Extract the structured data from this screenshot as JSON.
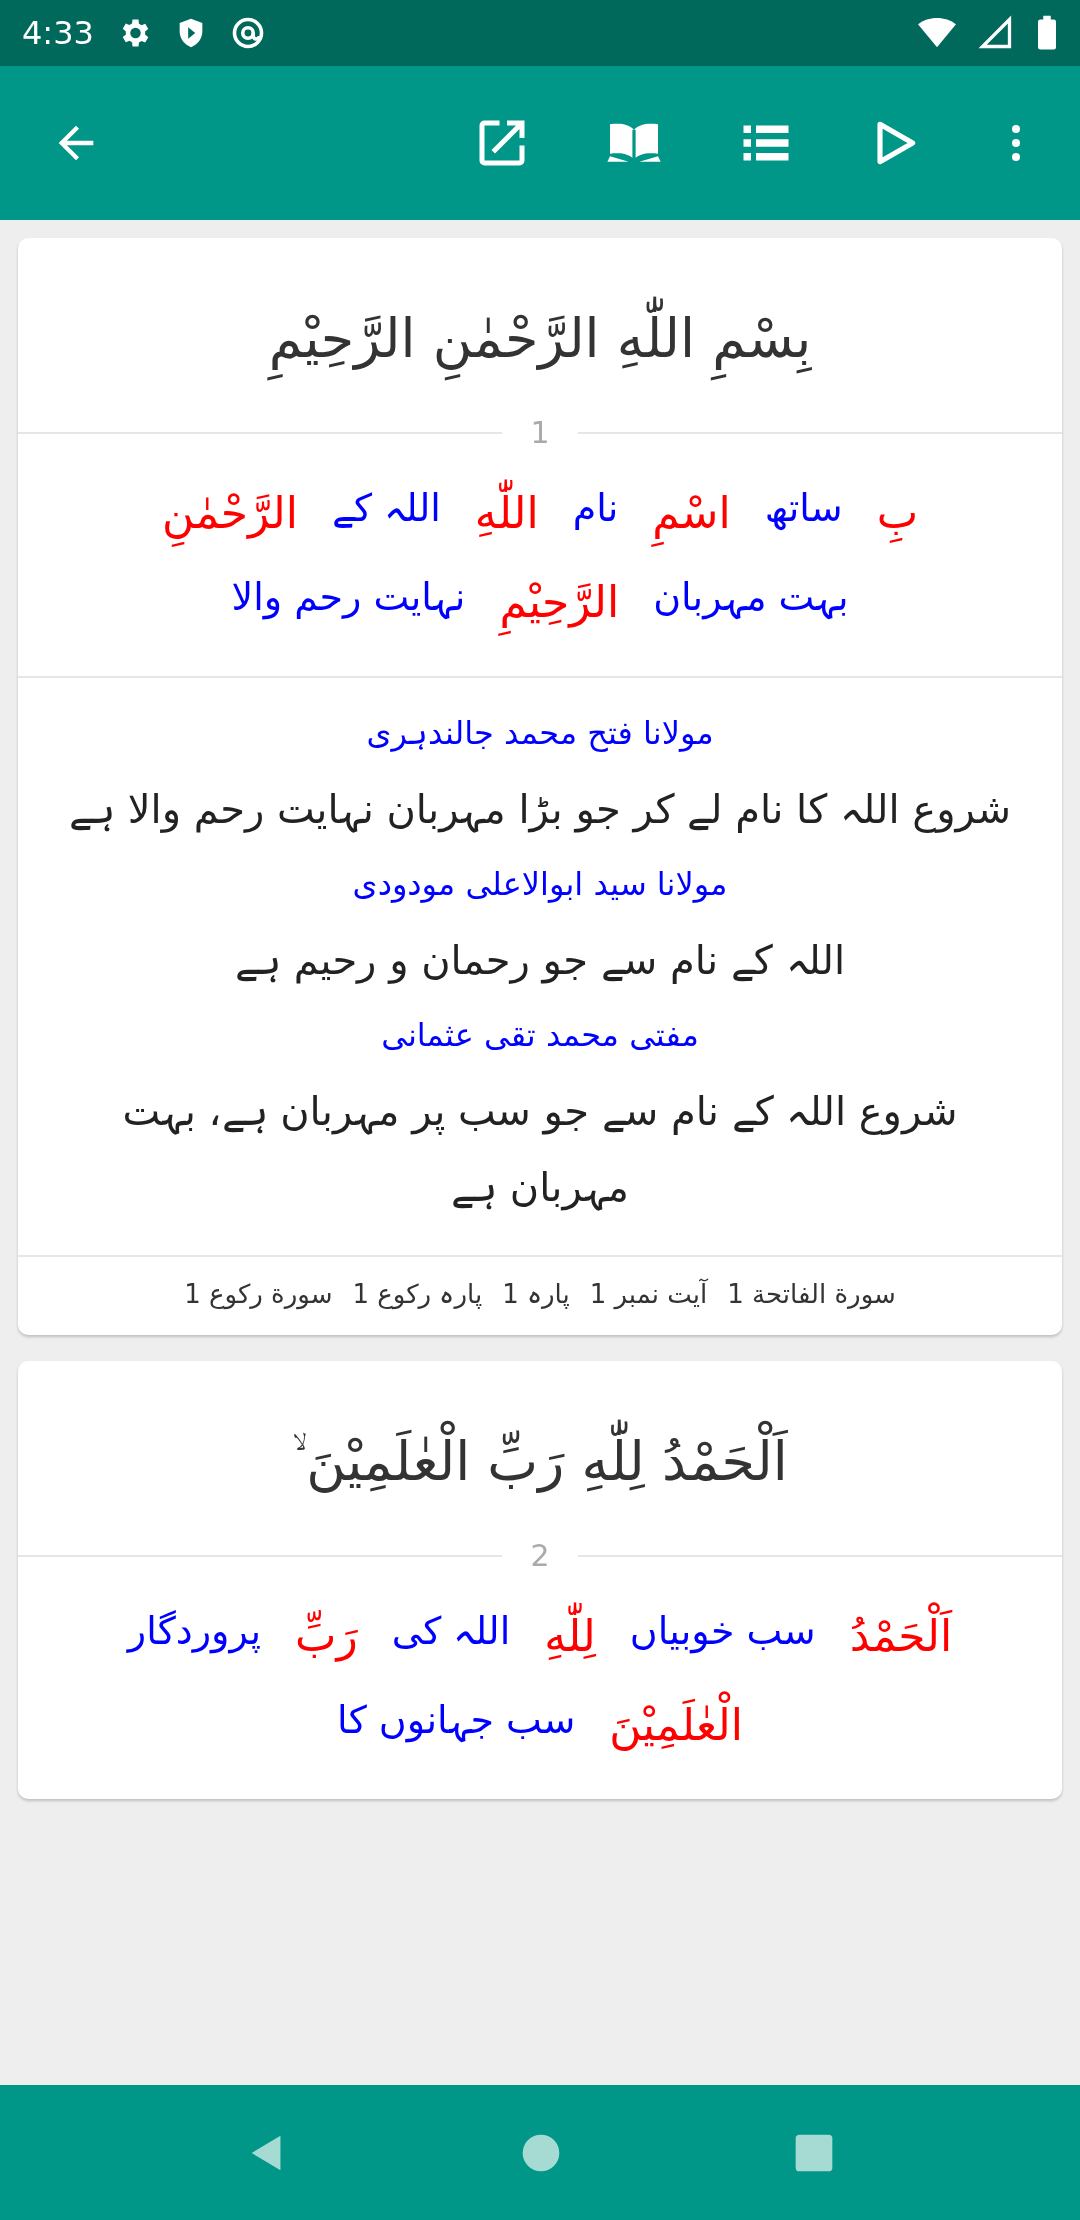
{
  "status_bar": {
    "time": "4:33"
  },
  "verses": [
    {
      "arabic": "بِسْمِ اللّٰهِ الرَّحْمٰنِ الرَّحِيْمِ",
      "number": "1",
      "words": [
        {
          "text": "بِ",
          "kind": "arabic"
        },
        {
          "text": "ساتھ",
          "kind": "urdu"
        },
        {
          "text": "اسْمِ",
          "kind": "arabic"
        },
        {
          "text": "نام",
          "kind": "urdu"
        },
        {
          "text": "اللّٰهِ",
          "kind": "arabic"
        },
        {
          "text": "اللہ کے",
          "kind": "urdu"
        },
        {
          "text": "الرَّحْمٰنِ",
          "kind": "arabic"
        },
        {
          "text": "بہت مہربان",
          "kind": "urdu"
        },
        {
          "text": "الرَّحِيْمِ",
          "kind": "arabic"
        },
        {
          "text": "نہایت رحم والا",
          "kind": "urdu"
        }
      ],
      "translations": [
        {
          "translator": "مولانا فتح محمد جالندہری",
          "text": "شروع اللہ کا نام لے کر جو بڑا مہربان نہایت رحم والا ہے"
        },
        {
          "translator": "مولانا سید ابوالاعلی مودودی",
          "text": "اللہ کے نام سے جو رحمان و رحیم ہے"
        },
        {
          "translator": "مفتی محمد تقی عثمانی",
          "text": "شروع اللہ کے نام سے جو سب پر مہربان ہے، بہت مہربان ہے"
        }
      ],
      "footer": [
        "سورة الفاتحة 1",
        "آیت نمبر 1",
        "پارہ 1",
        "پارہ رکوع 1",
        "سورة رکوع 1"
      ]
    },
    {
      "arabic": "اَلْحَمْدُ لِلّٰهِ رَبِّ الْعٰلَمِيْنَ ۙ",
      "number": "2",
      "words": [
        {
          "text": "اَلْحَمْدُ",
          "kind": "arabic"
        },
        {
          "text": "سب خوبیاں",
          "kind": "urdu"
        },
        {
          "text": "لِلّٰهِ",
          "kind": "arabic"
        },
        {
          "text": "اللہ کی",
          "kind": "urdu"
        },
        {
          "text": "رَبِّ",
          "kind": "arabic"
        },
        {
          "text": "پروردگار",
          "kind": "urdu"
        },
        {
          "text": "الْعٰلَمِيْنَ",
          "kind": "arabic"
        },
        {
          "text": "سب جہانوں کا",
          "kind": "urdu"
        }
      ]
    }
  ]
}
